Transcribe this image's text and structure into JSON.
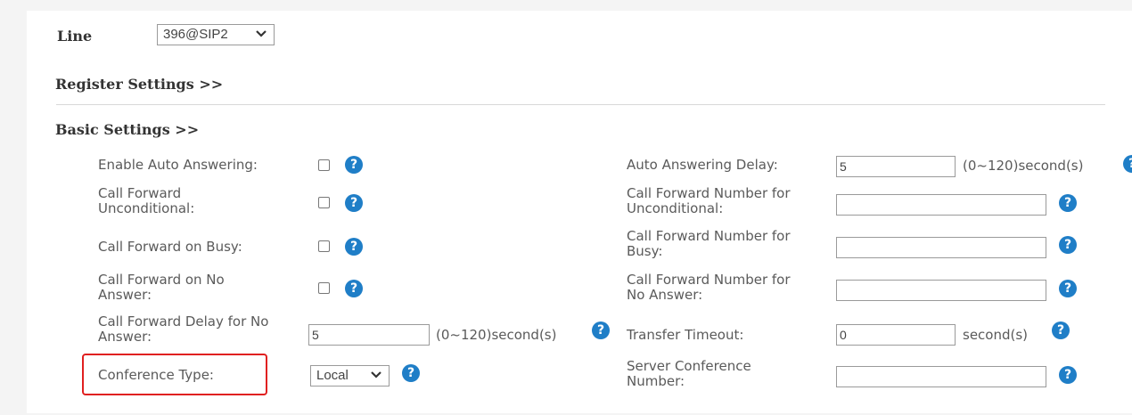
{
  "line": {
    "label": "Line",
    "value": "396@SIP2"
  },
  "sections": {
    "register": "Register Settings >>",
    "basic": "Basic Settings >>"
  },
  "left": {
    "auto_answer": "Enable Auto Answering:",
    "cf_uncond_1": "Call Forward",
    "cf_uncond_2": "Unconditional:",
    "cf_busy": "Call Forward on Busy:",
    "cf_noans_1": "Call Forward on No",
    "cf_noans_2": "Answer:",
    "cf_delay_1": "Call Forward Delay for No",
    "cf_delay_2": "Answer:",
    "cf_delay_value": "5",
    "cf_delay_unit": "(0~120)second(s)",
    "conference_type": "Conference Type:",
    "conference_value": "Local"
  },
  "right": {
    "auto_answer_delay": "Auto Answering Delay:",
    "auto_answer_delay_value": "5",
    "auto_answer_delay_unit": "(0~120)second(s)",
    "cfn_uncond_1": "Call Forward Number for",
    "cfn_uncond_2": "Unconditional:",
    "cfn_busy_1": "Call Forward Number for",
    "cfn_busy_2": "Busy:",
    "cfn_noans_1": "Call Forward Number for",
    "cfn_noans_2": "No Answer:",
    "transfer_timeout": "Transfer Timeout:",
    "transfer_timeout_value": "0",
    "transfer_timeout_unit": "second(s)",
    "server_conf_1": "Server Conference",
    "server_conf_2": "Number:"
  },
  "icons": {
    "help": "?"
  },
  "colors": {
    "help_icon": "#1f7ec7",
    "highlight_border": "#e02020"
  }
}
